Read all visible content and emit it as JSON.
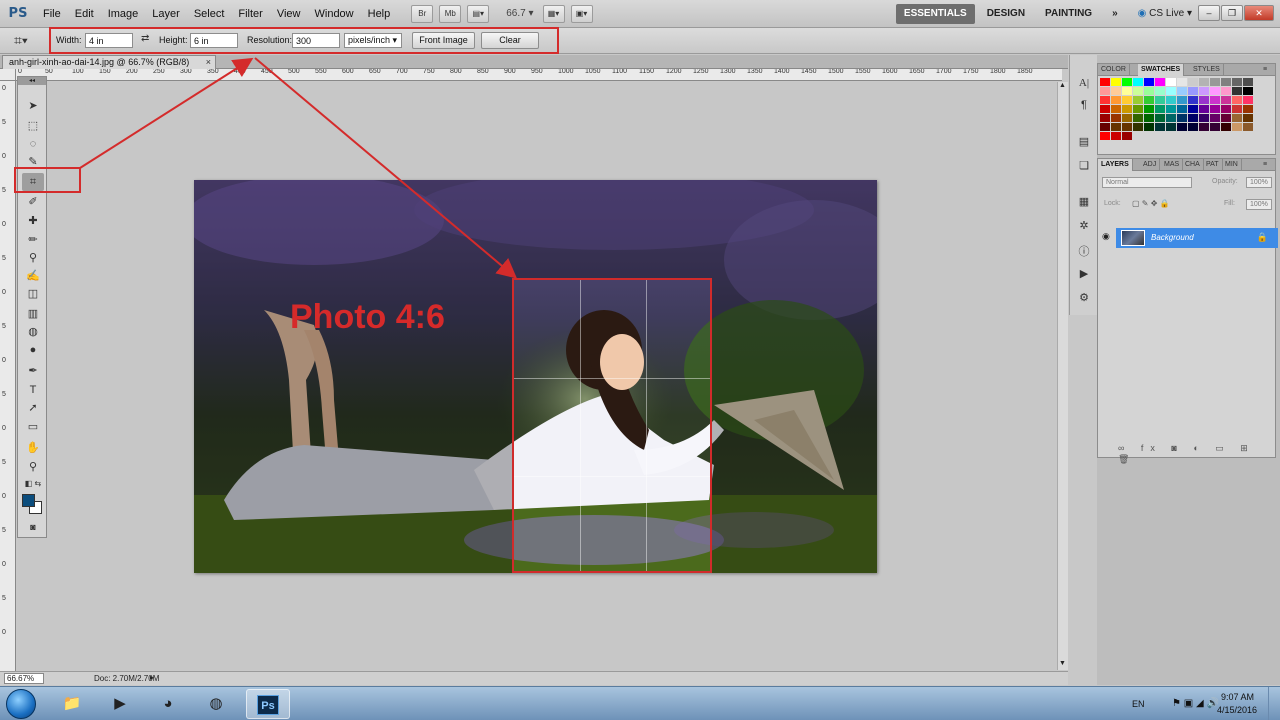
{
  "menu": {
    "logo": "PS",
    "items": [
      "File",
      "Edit",
      "Image",
      "Layer",
      "Select",
      "Filter",
      "View",
      "Window",
      "Help"
    ],
    "tool_badges": [
      "Br",
      "Mb"
    ],
    "zoom": "66.7",
    "workspaces": [
      "ESSENTIALS",
      "DESIGN",
      "PAINTING"
    ],
    "more": "»",
    "cslive": "CS Live"
  },
  "options": {
    "width_label": "Width:",
    "width_value": "4 in",
    "height_label": "Height:",
    "height_value": "6 in",
    "resolution_label": "Resolution:",
    "resolution_value": "300",
    "units": "pixels/inch",
    "front_image": "Front Image",
    "clear": "Clear"
  },
  "document": {
    "tab_title": "anh-girl-xinh-ao-dai-14.jpg @ 66.7% (RGB/8)",
    "overlay_text": "Photo 4:6",
    "ruler_top": [
      "0",
      "50",
      "100",
      "150",
      "200",
      "250",
      "300",
      "350",
      "400",
      "450",
      "500",
      "550",
      "600",
      "650",
      "700",
      "750",
      "800",
      "850",
      "900",
      "950",
      "1000",
      "1050",
      "1100",
      "1150",
      "1200",
      "1250",
      "1300",
      "1350",
      "1400",
      "1450",
      "1500",
      "1550",
      "1600",
      "1650",
      "1700",
      "1750",
      "1800",
      "1850"
    ],
    "ruler_left": [
      "0",
      "5",
      "0",
      "5",
      "0",
      "5",
      "0",
      "5",
      "0",
      "5",
      "0",
      "5",
      "0",
      "5",
      "0",
      "5",
      "0"
    ]
  },
  "status": {
    "zoom": "66.67%",
    "doc": "Doc: 2.70M/2.70M"
  },
  "panels": {
    "color_tabs": [
      "COLOR",
      "SWATCHES",
      "STYLES"
    ],
    "layers_tabs": [
      "LAYERS",
      "ADJ",
      "MAS",
      "CHA",
      "PAT",
      "MIN"
    ],
    "blend_mode": "Normal",
    "opacity_label": "Opacity:",
    "opacity_value": "100%",
    "lock_label": "Lock:",
    "fill_label": "Fill:",
    "fill_value": "100%",
    "layer_name": "Background"
  },
  "swatch_colors": [
    "#ff0000",
    "#ffff00",
    "#00ff00",
    "#00ffff",
    "#0000ff",
    "#ff00ff",
    "#ffffff",
    "#e6e6e6",
    "#cccccc",
    "#b3b3b3",
    "#999999",
    "#808080",
    "#666666",
    "#4d4d4d",
    "#ff9999",
    "#ffcc99",
    "#ffff99",
    "#ccff99",
    "#99ff99",
    "#99ffcc",
    "#99ffff",
    "#99ccff",
    "#9999ff",
    "#cc99ff",
    "#ff99ff",
    "#ff99cc",
    "#333333",
    "#000000",
    "#ff3333",
    "#ff9933",
    "#ffcc33",
    "#99cc33",
    "#33cc33",
    "#33cc99",
    "#33cccc",
    "#3399cc",
    "#3333cc",
    "#9933cc",
    "#cc33cc",
    "#cc3399",
    "#ff6666",
    "#ff3366",
    "#cc0000",
    "#cc6600",
    "#cc9900",
    "#669900",
    "#009900",
    "#009966",
    "#009999",
    "#006699",
    "#000099",
    "#660099",
    "#990099",
    "#990066",
    "#cc3333",
    "#993300",
    "#990000",
    "#993300",
    "#996600",
    "#336600",
    "#006600",
    "#006633",
    "#006666",
    "#003366",
    "#000066",
    "#330066",
    "#660066",
    "#660033",
    "#996633",
    "#663300",
    "#660000",
    "#663300",
    "#663300",
    "#333300",
    "#003300",
    "#003333",
    "#003333",
    "#000033",
    "#000033",
    "#330033",
    "#330033",
    "#330000",
    "#cc9966",
    "#8b5a2b",
    "#ff0000",
    "#cc0000",
    "#990000"
  ],
  "taskbar": {
    "lang": "EN",
    "time": "9:07 AM",
    "date": "4/15/2016",
    "ps_label": "Ps"
  }
}
